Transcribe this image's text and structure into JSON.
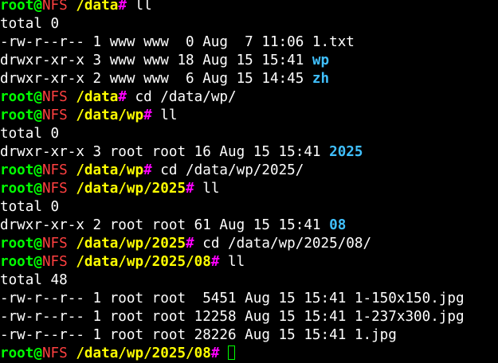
{
  "colors": {
    "background": "#000000",
    "text": "#ffffff",
    "user": "#00ff00",
    "host": "#ff4040",
    "path": "#ffff00",
    "hash": "#ff00ff",
    "directory": "#40c0ff"
  },
  "prompt": {
    "user": "root",
    "at": "@",
    "host": "NFS"
  },
  "lines": [
    {
      "type": "prompt",
      "path": "/data",
      "hash": "#",
      "command": " ll"
    },
    {
      "type": "output",
      "text": "total 0"
    },
    {
      "type": "output",
      "text": "-rw-r--r-- 1 www www  0 Aug  7 11:06 ",
      "file": "1.txt",
      "is_dir": false
    },
    {
      "type": "output",
      "text": "drwxr-xr-x 3 www www 18 Aug 15 15:41 ",
      "file": "wp",
      "is_dir": true
    },
    {
      "type": "output",
      "text": "drwxr-xr-x 2 www www  6 Aug 15 14:45 ",
      "file": "zh",
      "is_dir": true
    },
    {
      "type": "prompt",
      "path": "/data",
      "hash": "#",
      "command": " cd /data/wp/"
    },
    {
      "type": "prompt",
      "path": "/data/wp",
      "hash": "#",
      "command": " ll"
    },
    {
      "type": "output",
      "text": "total 0"
    },
    {
      "type": "output",
      "text": "drwxr-xr-x 3 root root 16 Aug 15 15:41 ",
      "file": "2025",
      "is_dir": true
    },
    {
      "type": "prompt",
      "path": "/data/wp",
      "hash": "#",
      "command": " cd /data/wp/2025/"
    },
    {
      "type": "prompt",
      "path": "/data/wp/2025",
      "hash": "#",
      "command": " ll"
    },
    {
      "type": "output",
      "text": "total 0"
    },
    {
      "type": "output",
      "text": "drwxr-xr-x 2 root root 61 Aug 15 15:41 ",
      "file": "08",
      "is_dir": true
    },
    {
      "type": "prompt",
      "path": "/data/wp/2025",
      "hash": "#",
      "command": " cd /data/wp/2025/08/"
    },
    {
      "type": "prompt",
      "path": "/data/wp/2025/08",
      "hash": "#",
      "command": " ll"
    },
    {
      "type": "output",
      "text": "total 48"
    },
    {
      "type": "output",
      "text": "-rw-r--r-- 1 root root  5451 Aug 15 15:41 ",
      "file": "1-150x150.jpg",
      "is_dir": false
    },
    {
      "type": "output",
      "text": "-rw-r--r-- 1 root root 12258 Aug 15 15:41 ",
      "file": "1-237x300.jpg",
      "is_dir": false
    },
    {
      "type": "output",
      "text": "-rw-r--r-- 1 root root 28226 Aug 15 15:41 ",
      "file": "1.jpg",
      "is_dir": false
    },
    {
      "type": "prompt",
      "path": "/data/wp/2025/08",
      "hash": "#",
      "command": " ",
      "cursor": true
    }
  ]
}
